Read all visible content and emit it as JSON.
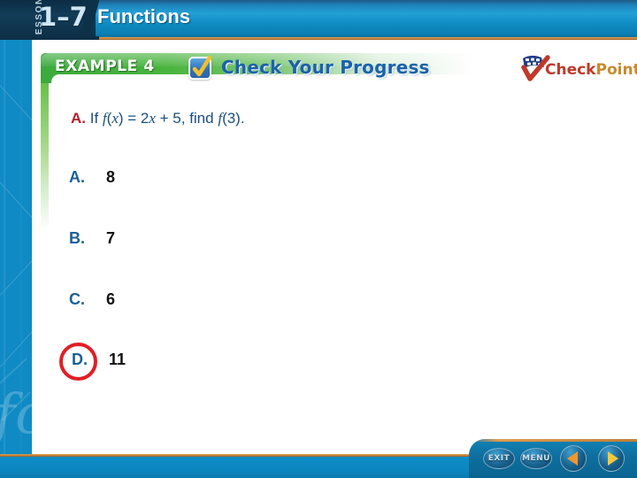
{
  "header": {
    "lesson_word": "LESSON",
    "lesson_number": "1–7",
    "title": "Functions"
  },
  "banner": {
    "example_label": "EXAMPLE 4",
    "check_icon": "checkbox-checked-icon",
    "progress_title": "Check Your Progress"
  },
  "logo": {
    "icon": "checkpoint-flag-icon",
    "check_text": "Check",
    "point_text": "Point"
  },
  "question": {
    "label": "A.",
    "prefix": "If ",
    "fn1": "f",
    "open1": "(",
    "var1": "x",
    "close1": ") = 2",
    "var2": "x",
    "middle": " + 5, find ",
    "fn2": "f",
    "suffix": "(3)."
  },
  "choices": [
    {
      "label": "A.",
      "value": "8",
      "selected": false
    },
    {
      "label": "B.",
      "value": "7",
      "selected": false
    },
    {
      "label": "C.",
      "value": "6",
      "selected": false
    },
    {
      "label": "D.",
      "value": "11",
      "selected": true
    }
  ],
  "nav": {
    "exit_label": "EXIT",
    "menu_label": "MENU",
    "back_icon": "back-arrow-icon",
    "next_icon": "next-arrow-icon"
  },
  "colors": {
    "header_blue": "#0e8cc4",
    "rail_blue": "#0f8ac4",
    "banner_green": "#3caa3e",
    "question_blue": "#1b4f7e",
    "question_label_red": "#b5202b",
    "choice_label_blue": "#1b5f96",
    "answer_ring_red": "#e01f26",
    "accent_orange": "#c07f38",
    "checkpoint_red": "#c0392b",
    "checkpoint_gold": "#c78a2c"
  }
}
